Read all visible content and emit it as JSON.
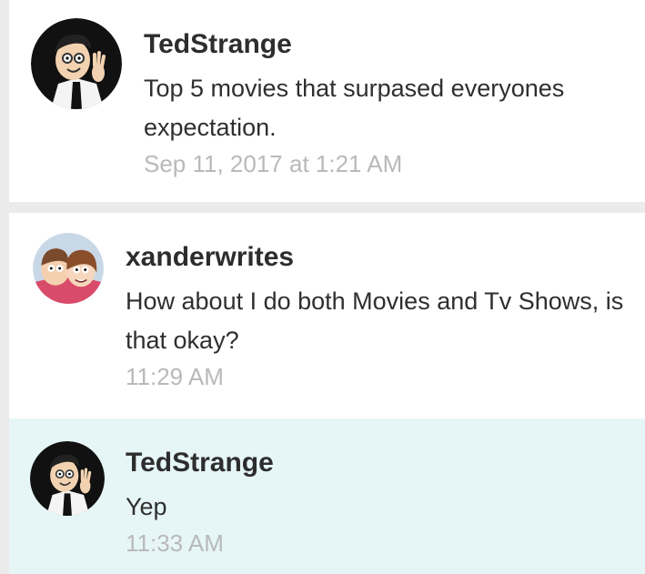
{
  "messages": [
    {
      "username": "TedStrange",
      "avatar_icon": "dipper-cartoon-avatar",
      "text": "Top 5 movies that surpased everyones expectation.",
      "timestamp": "Sep 11, 2017 at 1:21 AM"
    },
    {
      "username": "xanderwrites",
      "avatar_icon": "mabel-dipper-cartoon-avatar",
      "text": "How about I do both Movies and Tv Shows, is that okay?",
      "timestamp": "11:29 AM"
    },
    {
      "username": "TedStrange",
      "avatar_icon": "dipper-cartoon-avatar",
      "text": "Yep",
      "timestamp": "11:33 AM"
    }
  ],
  "colors": {
    "page_background": "#ebebeb",
    "card_background": "#ffffff",
    "highlight_background": "#e6f6f7",
    "username": "#2d2d2d",
    "text": "#2f2f2f",
    "timestamp": "#b9b9b9"
  }
}
